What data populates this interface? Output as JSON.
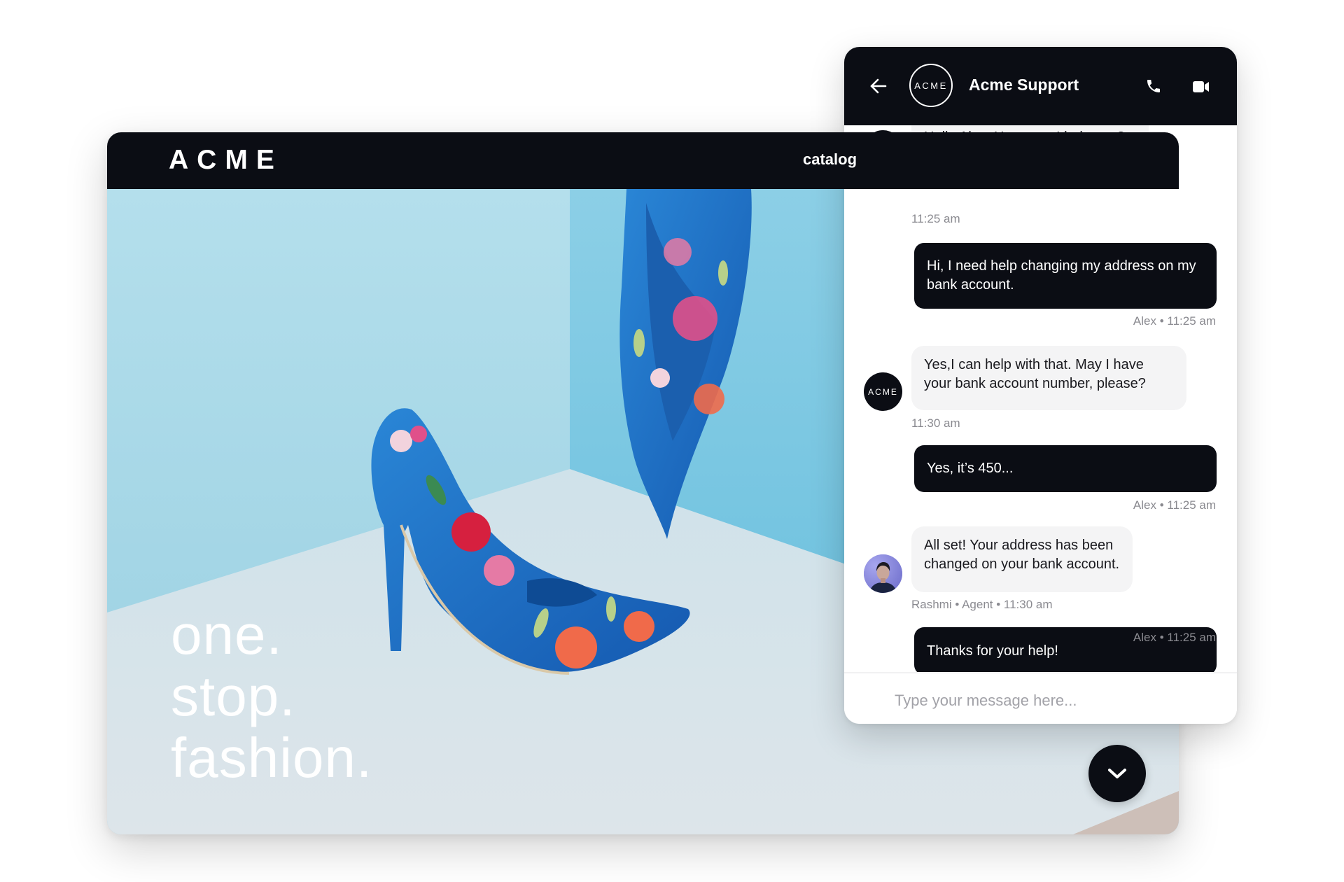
{
  "site": {
    "logo": "ACME",
    "nav_link": "catalog",
    "tagline": [
      "one.",
      "stop.",
      "fashion."
    ],
    "hero_image": "floral-pumps-photo",
    "colors": {
      "nav": "#0b0d14",
      "wall_left": "#b1dcea",
      "wall_right": "#8bcde5",
      "floor": "#dde6ec",
      "shoe_blue": "#1f6fc4",
      "flower_pink": "#e0508a",
      "flower_red": "#d6203f",
      "flower_coral": "#f06a4a",
      "leaf": "#b7d08a"
    },
    "fab_icon": "chevron-down-icon"
  },
  "chat": {
    "header": {
      "back_icon": "arrow-left-icon",
      "logo": "ACME",
      "title": "Acme Support",
      "call_icon": "phone-icon",
      "video_icon": "video-icon"
    },
    "messages": [
      {
        "from": "agent",
        "avatar": "ACME",
        "text": "Hello Alex, How may I help you?",
        "meta": "11:25 am"
      },
      {
        "from": "user",
        "text": "Hi, I need help changing my address on my bank account.",
        "meta": "Alex • 11:25 am"
      },
      {
        "from": "agent",
        "avatar": "ACME",
        "text": "Yes,I can help with that. May I have your bank account number, please?",
        "meta": "11:30 am"
      },
      {
        "from": "user",
        "text": "Yes, it’s 450...",
        "meta": "Alex • 11:25 am"
      },
      {
        "from": "agent",
        "avatar": "photo",
        "text": "All set! Your address has been changed on your bank account.",
        "meta": "Rashmi • Agent • 11:30 am"
      },
      {
        "from": "user",
        "text": "Thanks for your help!",
        "meta": "Alex • 11:25 am"
      }
    ],
    "input": {
      "placeholder": "Type your message here...",
      "value": ""
    },
    "colors": {
      "dark": "#0b0d14",
      "incoming_bubble": "#f4f4f5",
      "meta_text": "#8a8a90"
    }
  }
}
